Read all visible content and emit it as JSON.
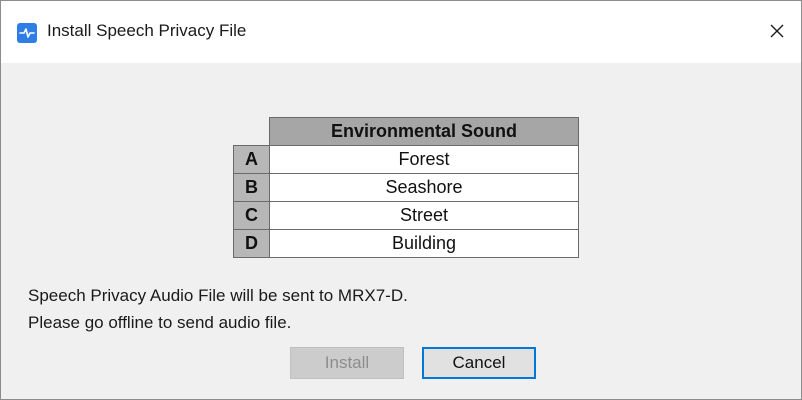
{
  "window": {
    "title": "Install Speech Privacy File",
    "close_glyph": "✕",
    "icon": "app-logo-icon"
  },
  "table": {
    "header": "Environmental Sound",
    "rows": [
      {
        "letter": "A",
        "value": "Forest"
      },
      {
        "letter": "B",
        "value": "Seashore"
      },
      {
        "letter": "C",
        "value": "Street"
      },
      {
        "letter": "D",
        "value": "Building"
      }
    ]
  },
  "message": {
    "line1": "Speech Privacy Audio File will be sent to MRX7-D.",
    "line2": "Please go offline to send audio file."
  },
  "buttons": {
    "install": "Install",
    "install_enabled": false,
    "cancel": "Cancel"
  },
  "colors": {
    "accent": "#0078d7",
    "icon_bg": "#2f7ee6"
  }
}
